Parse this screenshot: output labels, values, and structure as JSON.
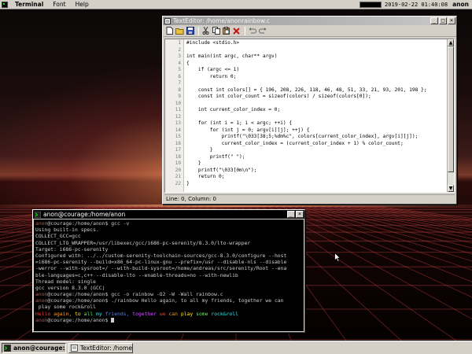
{
  "menubar": {
    "items": [
      "Terminal",
      "Font",
      "Help"
    ],
    "clock": "2019-02-22 01:40:08",
    "user": "anon"
  },
  "editor": {
    "title": "TextEditor: /home/anonrainbow.c",
    "toolbar_icons": [
      "new-file-icon",
      "open-file-icon",
      "save-file-icon",
      "cut-icon",
      "copy-icon",
      "paste-icon",
      "delete-icon",
      "undo-icon",
      "redo-icon"
    ],
    "line_numbers": [
      "1",
      "2",
      "3",
      "4",
      "5",
      "6",
      "7",
      "8",
      "9",
      "10",
      "11",
      "12",
      "13",
      "14",
      "15",
      "16",
      "17",
      "18",
      "19",
      "20",
      "21",
      "22"
    ],
    "code_lines": [
      "#include <stdio.h>",
      "",
      "int main(int argc, char** argv)",
      "{",
      "    if (argc <= 1)",
      "        return 0;",
      "",
      "    const int colors[] = { 196, 208, 226, 118, 46, 48, 51, 33, 21, 93, 201, 198 };",
      "    const int color_count = sizeof(colors) / sizeof(colors[0]);",
      "",
      "    int current_color_index = 0;",
      "",
      "    for (int i = 1; i < argc; ++i) {",
      "        for (int j = 0; argv[i][j]; ++j) {",
      "            printf(\"\\033[38;5;%dm%c\", colors[current_color_index], argv[i][j]);",
      "            current_color_index = (current_color_index + 1) % color_count;",
      "        }",
      "        printf(\" \");",
      "    }",
      "    printf(\"\\033[0m\\n\");",
      "    return 0;",
      "}"
    ],
    "status": "Line: 0, Column: 0"
  },
  "terminal": {
    "title": "anon@courage:/home/anon",
    "lines": [
      {
        "user": "anon",
        "rest": "@courage:/home/anon$ gcc -v"
      },
      {
        "text": "Using built-in specs."
      },
      {
        "text": "COLLECT_GCC=gcc"
      },
      {
        "text": "COLLECT_LTO_WRAPPER=/usr/libexec/gcc/i686-pc-serenity/8.3.0/lto-wrapper"
      },
      {
        "text": "Target: i686-pc-serenity"
      },
      {
        "text": "Configured with: ../../custom-serenity-toolchain-sources/gcc-8.3.0/configure --host"
      },
      {
        "text": "=i686-pc-serenity --build=x86_64-pc-linux-gnu --prefix=/usr --disable-nls --disable"
      },
      {
        "text": "-werror --with-sysroot=/ --with-build-sysroot=/home/andreas/src/serenity/Root --ena"
      },
      {
        "text": "ble-languages=c,c++ --disable-lto --enable-threads=no --with-newlib"
      },
      {
        "text": "Thread model: single"
      },
      {
        "text": "gcc version 8.3.0 (GCC)"
      },
      {
        "user": "anon",
        "rest": "@courage:/home/anon$ gcc -o rainbow -O2 -W -Wall rainbow.c"
      },
      {
        "user": "anon",
        "rest": "@courage:/home/anon$ ./rainbow Hello again, to all my friends, together we can"
      },
      {
        "text": " play some rock&roll"
      }
    ],
    "rainbow_words": [
      "Hello",
      "again,",
      "to",
      "all",
      "my",
      "friends,",
      "together",
      "we",
      "can",
      "play",
      "some",
      "rock&roll"
    ],
    "final_prompt_user": "anon",
    "final_prompt_rest": "@courage:/home/anon$ "
  },
  "taskbar": {
    "tasks": [
      {
        "label": "anon@courage:/home/a...",
        "active": true
      },
      {
        "label": "TextEditor: /home/a...",
        "active": false
      }
    ]
  }
}
